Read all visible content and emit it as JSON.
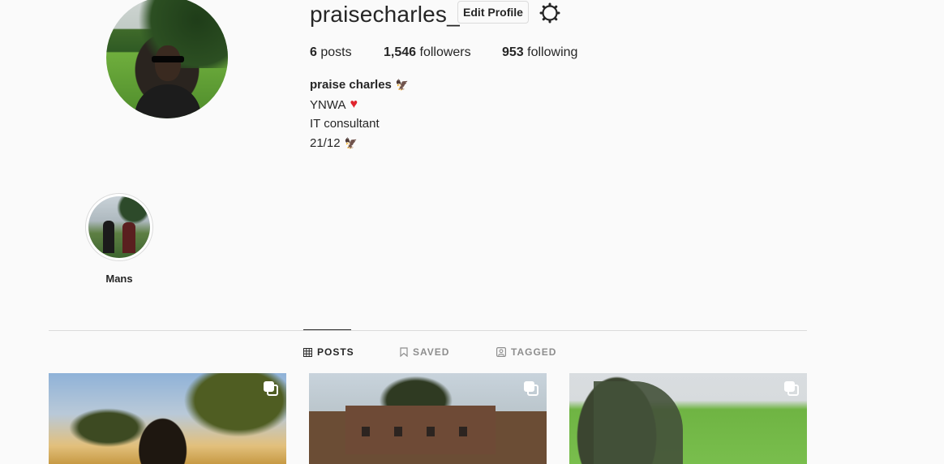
{
  "profile": {
    "username": "praisecharles_",
    "edit_label": "Edit Profile",
    "settings_icon": "gear-icon",
    "stats": {
      "posts_count": "6",
      "posts_label": "posts",
      "followers_count": "1,546",
      "followers_label": "followers",
      "following_count": "953",
      "following_label": "following"
    },
    "bio": {
      "name": "praise charles",
      "name_emoji": "🦅",
      "line1": "YNWA",
      "line1_emoji": "♥",
      "line2": "IT consultant",
      "line3": "21/12",
      "line3_emoji": "🦅"
    }
  },
  "highlights": [
    {
      "label": "Mans"
    }
  ],
  "tabs": {
    "posts": "POSTS",
    "saved": "SAVED",
    "tagged": "TAGGED",
    "active": "posts"
  },
  "posts": [
    {
      "type": "carousel"
    },
    {
      "type": "carousel"
    },
    {
      "type": "carousel"
    }
  ],
  "colors": {
    "background": "#fafafa",
    "text": "#262626",
    "muted": "#8e8e8e",
    "border": "#dbdbdb",
    "heart": "#e0242e"
  }
}
